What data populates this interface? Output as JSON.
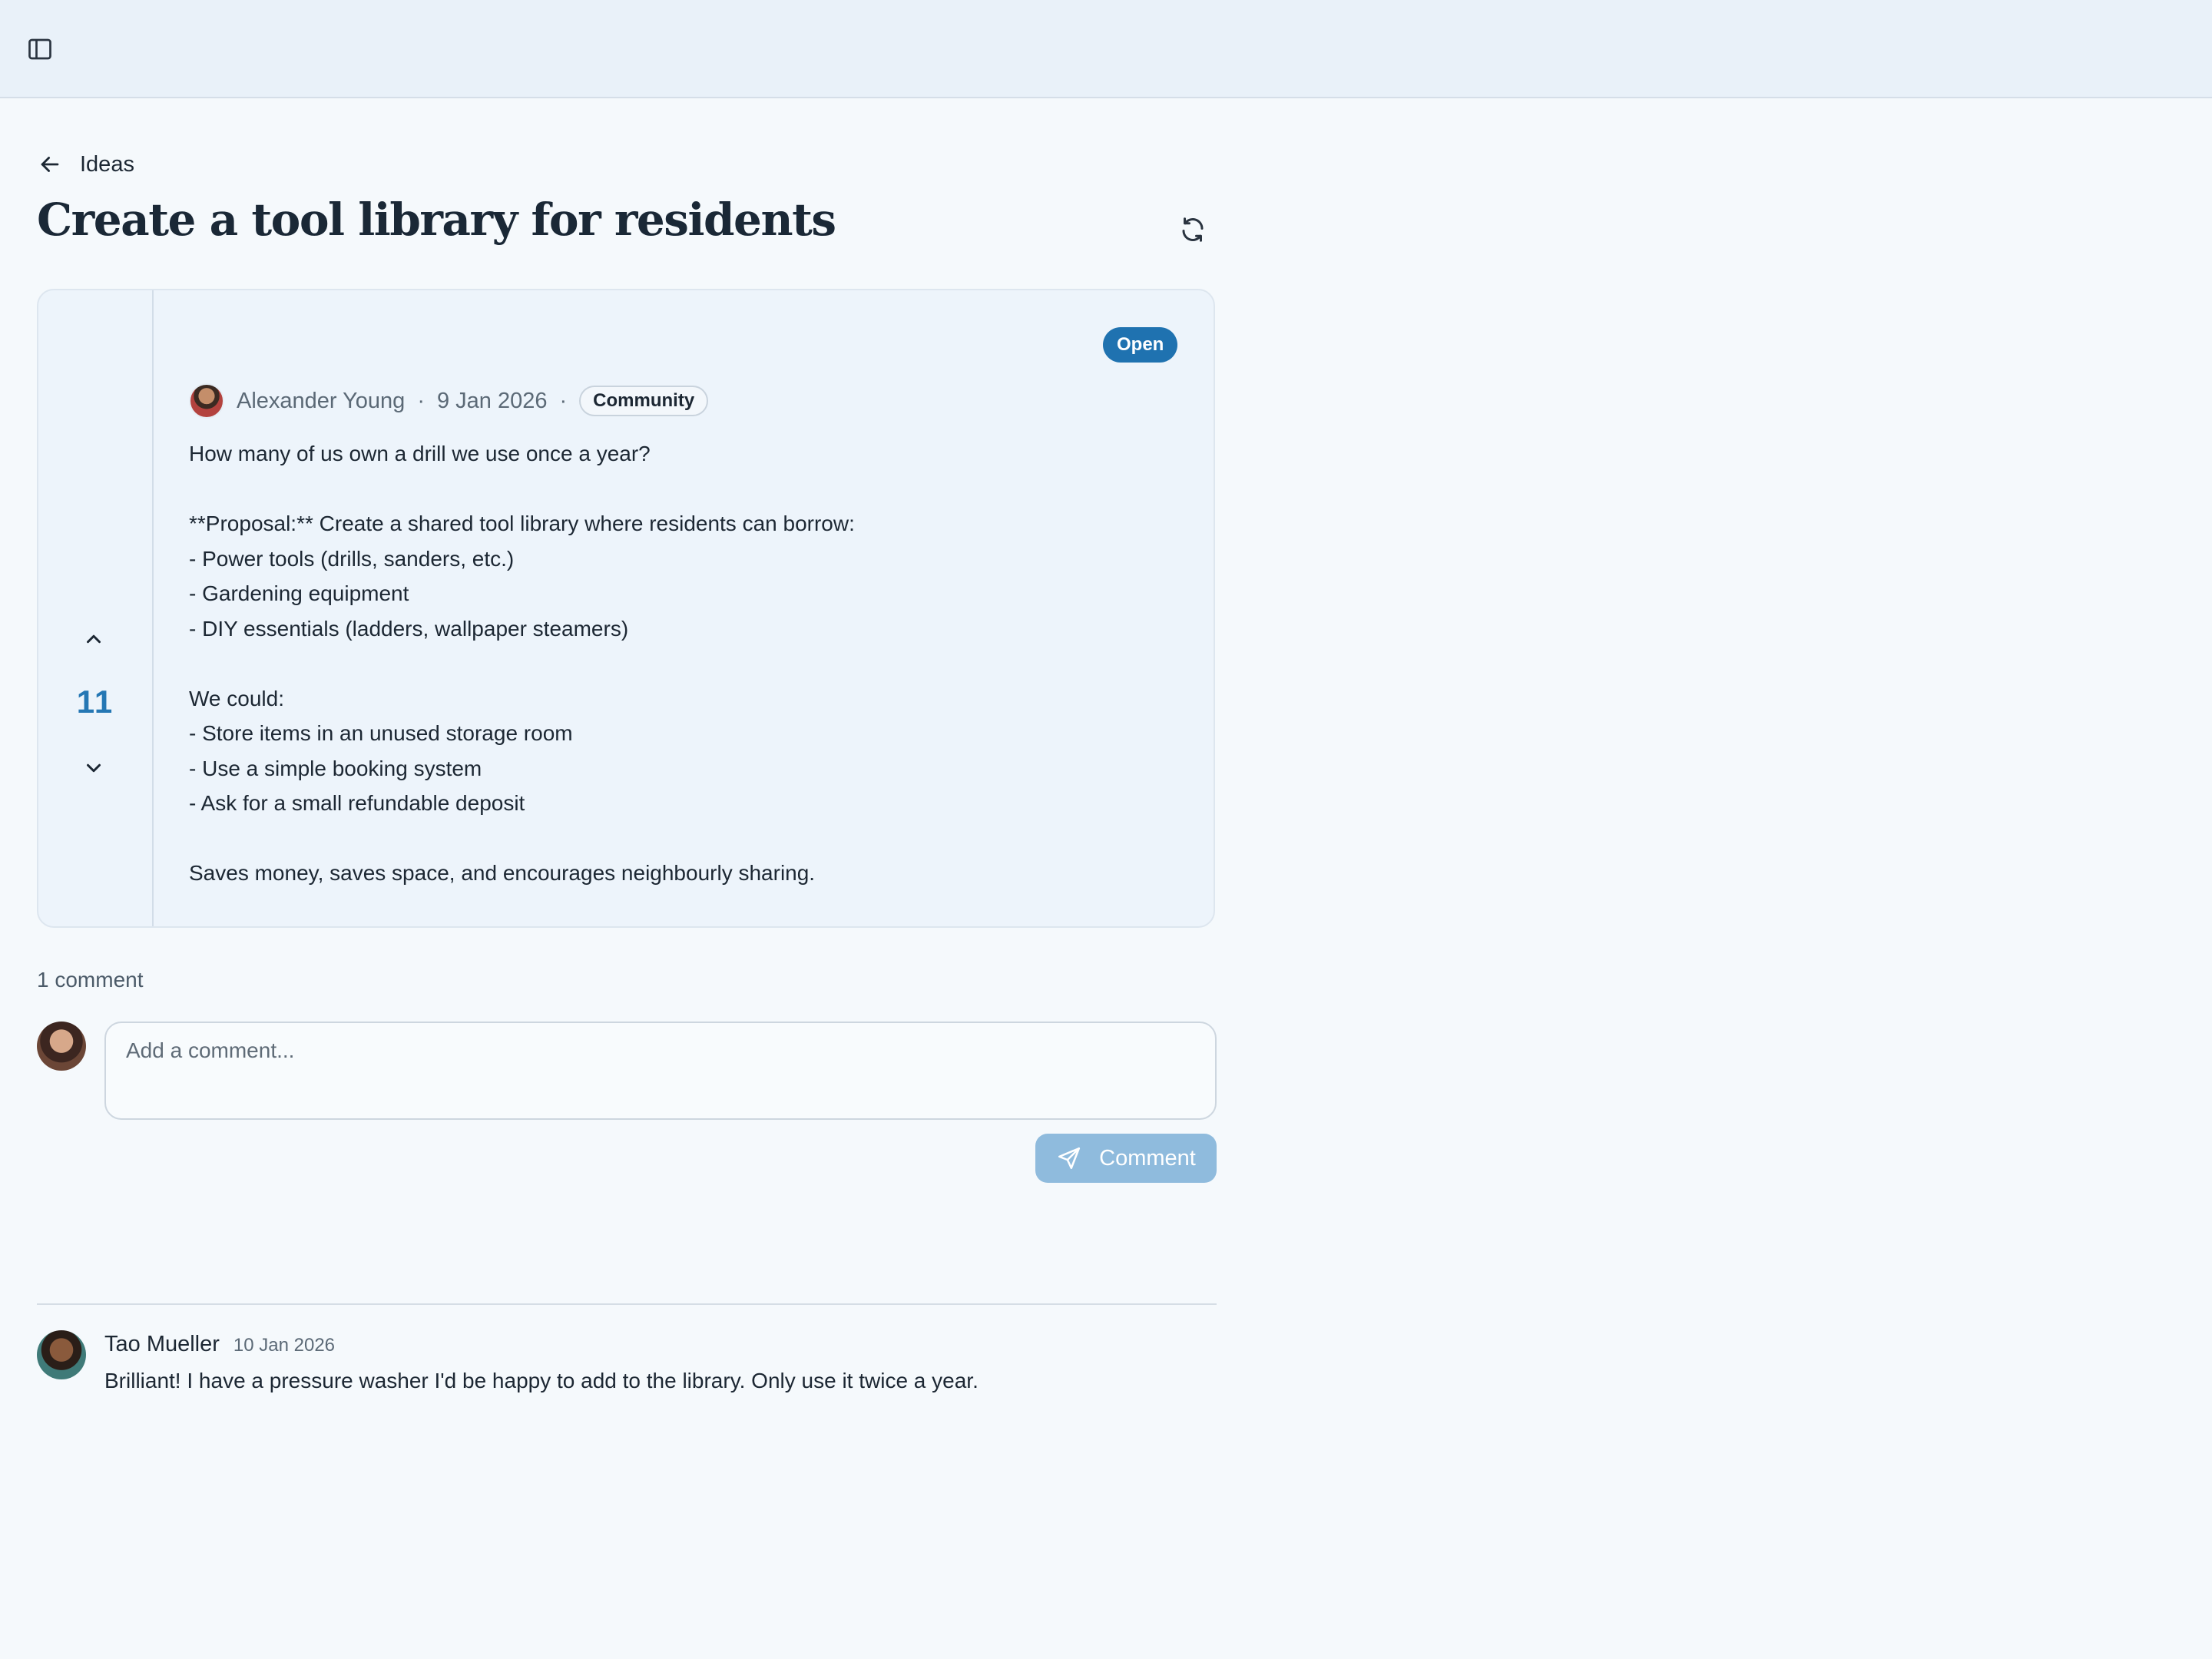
{
  "header": {
    "sidebar_toggle_icon": "sidebar-panel-icon"
  },
  "breadcrumb": {
    "back_icon": "arrow-left-icon",
    "label": "Ideas"
  },
  "idea": {
    "title": "Create a tool library for residents",
    "refresh_icon": "refresh-icon",
    "status": "Open",
    "votes": "11",
    "author": "Alexander Young",
    "date": "9 Jan 2026",
    "separator": "·",
    "category": "Community",
    "body_lines": [
      "How many of us own a drill we use once a year?",
      "",
      "**Proposal:** Create a shared tool library where residents can borrow:",
      "- Power tools (drills, sanders, etc.)",
      "- Gardening equipment",
      "- DIY essentials (ladders, wallpaper steamers)",
      "",
      "We could:",
      "- Store items in an unused storage room",
      "- Use a simple booking system",
      "- Ask for a small refundable deposit",
      "",
      "Saves money, saves space, and encourages neighbourly sharing."
    ]
  },
  "comments": {
    "count_label": "1 comment",
    "input_placeholder": "Add a comment...",
    "submit_label": "Comment",
    "items": [
      {
        "author": "Tao Mueller",
        "date": "10 Jan 2026",
        "text": "Brilliant! I have a pressure washer I'd be happy to add to the library. Only use it twice a year."
      }
    ]
  },
  "colors": {
    "accent": "#1f72b0",
    "vote_count": "#2577b4",
    "comment_button": "#8fbbdd",
    "page_background": "#f5f9fc"
  }
}
